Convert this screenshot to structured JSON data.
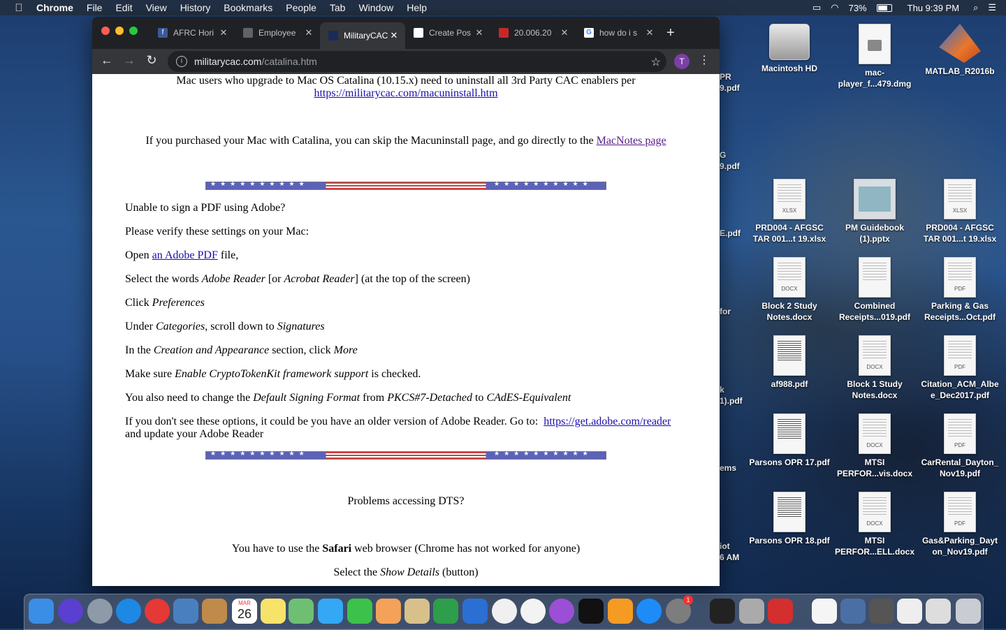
{
  "menubar": {
    "app": "Chrome",
    "items": [
      "File",
      "Edit",
      "View",
      "History",
      "Bookmarks",
      "People",
      "Tab",
      "Window",
      "Help"
    ],
    "battery": "73%",
    "clock": "Thu 9:39 PM"
  },
  "browser": {
    "tabs": [
      {
        "title": "AFRC Hori",
        "favicon_color": "#3b5998",
        "favicon_glyph": "f"
      },
      {
        "title": "Employee",
        "favicon_color": "#5f6368",
        "favicon_glyph": ""
      },
      {
        "title": "MilitaryCAC",
        "favicon_color": "#1c2a5a",
        "favicon_glyph": ""
      },
      {
        "title": "Create Pos",
        "favicon_color": "#ffffff",
        "favicon_glyph": ""
      },
      {
        "title": "20.006.20",
        "favicon_color": "#c62828",
        "favicon_glyph": ""
      },
      {
        "title": "how do i s",
        "favicon_color": "#ffffff",
        "favicon_glyph": "G"
      }
    ],
    "url_domain": "militarycac.com",
    "url_path": "/catalina.htm",
    "profile_initial": "T"
  },
  "page": {
    "intro_text": "Mac users who upgrade to Mac OS Catalina (10.15.x) need to uninstall all 3rd Party CAC enablers per",
    "intro_link": "https://militarycac.com/macuninstall.htm",
    "purchased_text": "If you purchased your Mac with Catalina, you can skip the Macuninstall page, and go directly to the",
    "purchased_link": "MacNotes page",
    "q_sign": "Unable to sign a PDF using Adobe?",
    "verify": "Please verify these settings on your Mac:",
    "open_pre": "Open",
    "open_link": "an Adobe PDF",
    "open_post": "file,",
    "select_a": "Select the words",
    "select_b": "Adobe Reader",
    "select_c": "[or",
    "select_d": "Acrobat Reader",
    "select_e": "] (at the top of the screen)",
    "click_a": "Click",
    "click_b": "Preferences",
    "under_a": "Under",
    "under_b": "Categories",
    "under_c": ", scroll down to",
    "under_d": "Signatures",
    "creation_a": "In the",
    "creation_b": "Creation and Appearance",
    "creation_c": "section, click",
    "creation_d": "More",
    "make_a": "Make sure",
    "make_b": "Enable CryptoTokenKit framework support",
    "make_c": "is checked.",
    "change_a": "You also need to change the",
    "change_b": "Default Signing Format",
    "change_c": "from",
    "change_d": "PKCS#7-Detached",
    "change_e": "to",
    "change_f": "CAdES-Equivalent",
    "older_a": "If you don't see these options, it could be you have an older version of Adobe Reader.  Go to:",
    "older_link": "https://get.adobe.com/reader",
    "older_b": "and update your Adobe Reader",
    "dts": "Problems accessing DTS?",
    "safari_a": "You have to use the",
    "safari_b": "Safari",
    "safari_c": "web browser (Chrome has not worked for anyone)",
    "details_a": "Select the",
    "details_b": "Show Details",
    "details_c": "(button)",
    "flag_stars": "★★★★★★★★★★"
  },
  "desktop": {
    "icons": [
      {
        "label": "Macintosh HD",
        "kind": "drive",
        "tag": ""
      },
      {
        "label": "mac-player_f...479.dmg",
        "kind": "dmg",
        "tag": ""
      },
      {
        "label": "MATLAB_R2016b",
        "kind": "matlab",
        "tag": ""
      },
      {
        "label": "PRD004 - AFGSC TAR 001...t 19.xlsx",
        "kind": "doc",
        "tag": "XLSX"
      },
      {
        "label": "PM Guidebook (1).pptx",
        "kind": "pptx",
        "tag": ""
      },
      {
        "label": "PRD004 - AFGSC TAR 001...t 19.xlsx",
        "kind": "doc",
        "tag": "XLSX"
      },
      {
        "label": "Block 2 Study Notes.docx",
        "kind": "doc",
        "tag": "DOCX"
      },
      {
        "label": "Combined Receipts...019.pdf",
        "kind": "doc",
        "tag": ""
      },
      {
        "label": "Parking & Gas Receipts...Oct.pdf",
        "kind": "doc",
        "tag": "PDF"
      },
      {
        "label": "af988.pdf",
        "kind": "dark",
        "tag": ""
      },
      {
        "label": "Block 1 Study Notes.docx",
        "kind": "doc",
        "tag": "DOCX"
      },
      {
        "label": "Citation_ACM_Albe e_Dec2017.pdf",
        "kind": "doc",
        "tag": "PDF"
      },
      {
        "label": "Parsons OPR 17.pdf",
        "kind": "dark",
        "tag": ""
      },
      {
        "label": "MTSI PERFOR...vis.docx",
        "kind": "doc",
        "tag": "DOCX"
      },
      {
        "label": "CarRental_Dayton_ Nov19.pdf",
        "kind": "doc",
        "tag": "PDF"
      },
      {
        "label": "Parsons OPR 18.pdf",
        "kind": "dark",
        "tag": ""
      },
      {
        "label": "MTSI PERFOR...ELL.docx",
        "kind": "doc",
        "tag": "DOCX"
      },
      {
        "label": "Gas&Parking_Dayt on_Nov19.pdf",
        "kind": "doc",
        "tag": "PDF"
      }
    ],
    "partial_labels": [
      "PR",
      "9.pdf",
      "G",
      "9.pdf",
      "E.pdf",
      "for",
      "k",
      "1).pdf",
      "ems",
      "iot",
      "6 AM"
    ]
  },
  "dock": {
    "calendar_month": "MAR",
    "calendar_day": "26",
    "badge": "1",
    "apps": [
      {
        "name": "finder",
        "color": "#3a8ee6"
      },
      {
        "name": "siri",
        "color": "#5a3fd1"
      },
      {
        "name": "launchpad",
        "color": "#8f9aa8"
      },
      {
        "name": "safari",
        "color": "#1e88e5"
      },
      {
        "name": "chrome",
        "color": "#e53935"
      },
      {
        "name": "preview-bird",
        "color": "#4a7fbf"
      },
      {
        "name": "contacts",
        "color": "#c08a4a"
      },
      {
        "name": "calendar",
        "color": "#ffffff"
      },
      {
        "name": "notes",
        "color": "#f7e36a"
      },
      {
        "name": "maps",
        "color": "#6fbf73"
      },
      {
        "name": "messages",
        "color": "#34a7f5"
      },
      {
        "name": "facetime",
        "color": "#3cc24a"
      },
      {
        "name": "photos",
        "color": "#f4a259"
      },
      {
        "name": "keynote-preview",
        "color": "#d7c08a"
      },
      {
        "name": "numbers",
        "color": "#2e9e4a"
      },
      {
        "name": "keynote",
        "color": "#2a6fd1"
      },
      {
        "name": "news",
        "color": "#f0f0f0"
      },
      {
        "name": "music",
        "color": "#f3f3f3"
      },
      {
        "name": "podcasts",
        "color": "#9b4fd6"
      },
      {
        "name": "apple-tv",
        "color": "#111111"
      },
      {
        "name": "books",
        "color": "#f59b23"
      },
      {
        "name": "app-store",
        "color": "#1d8cf8"
      },
      {
        "name": "system-preferences",
        "color": "#7d7d7d"
      },
      {
        "name": "activity-monitor",
        "color": "#222222"
      },
      {
        "name": "keychain",
        "color": "#aaaaaa"
      },
      {
        "name": "acrobat",
        "color": "#d32f2f"
      },
      {
        "name": "textedit",
        "color": "#f5f5f5"
      },
      {
        "name": "downloads",
        "color": "#4a6fa5"
      },
      {
        "name": "stack",
        "color": "#555555"
      },
      {
        "name": "document",
        "color": "#eeeeee"
      },
      {
        "name": "document2",
        "color": "#dddddd"
      },
      {
        "name": "trash",
        "color": "#c9ccd2"
      }
    ]
  }
}
